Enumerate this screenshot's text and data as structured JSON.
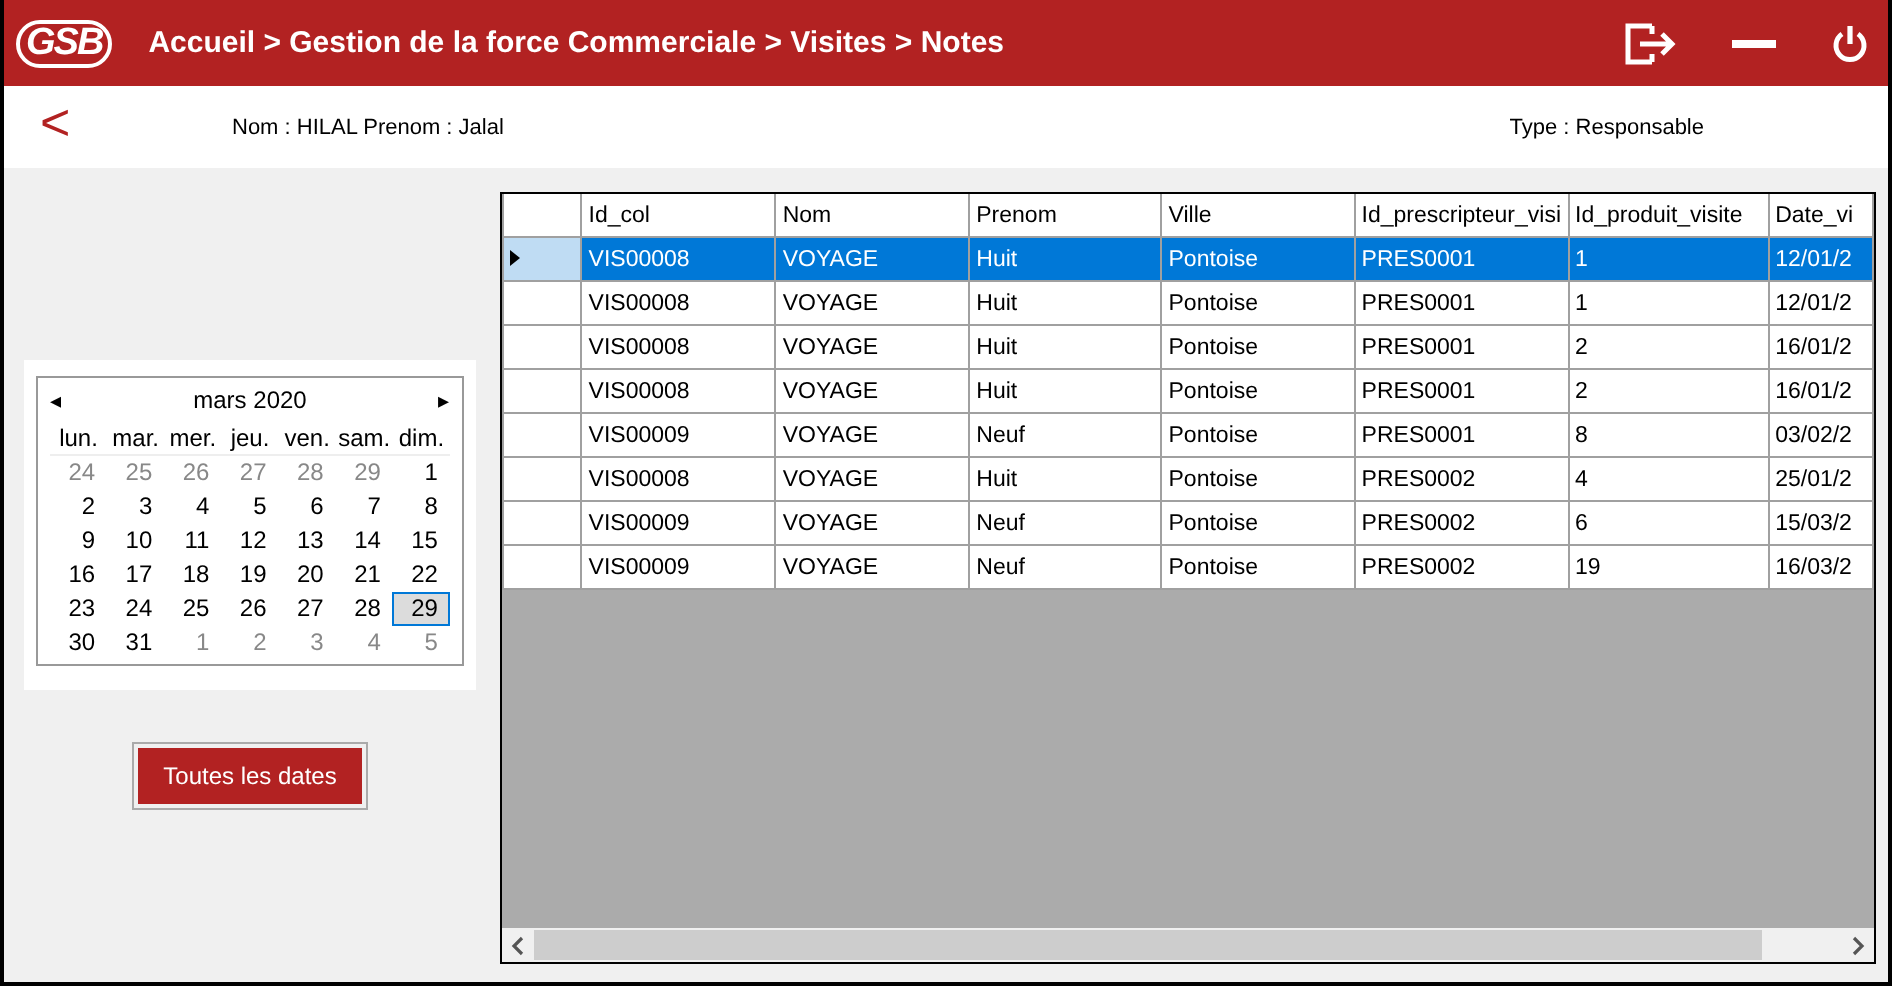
{
  "header": {
    "logo": "GSB",
    "breadcrumb": "Accueil > Gestion de la force Commerciale > Visites > Notes"
  },
  "info": {
    "back": "<",
    "user": "Nom : HILAL  Prenom : Jalal",
    "type": "Type : Responsable"
  },
  "calendar": {
    "prev": "◂",
    "next": "▸",
    "month": "mars 2020",
    "weekdays": [
      "lun.",
      "mar.",
      "mer.",
      "jeu.",
      "ven.",
      "sam.",
      "dim."
    ],
    "days": [
      {
        "label": "24",
        "other": true,
        "selected": false
      },
      {
        "label": "25",
        "other": true,
        "selected": false
      },
      {
        "label": "26",
        "other": true,
        "selected": false
      },
      {
        "label": "27",
        "other": true,
        "selected": false
      },
      {
        "label": "28",
        "other": true,
        "selected": false
      },
      {
        "label": "29",
        "other": true,
        "selected": false
      },
      {
        "label": "1",
        "other": false,
        "selected": false
      },
      {
        "label": "2",
        "other": false,
        "selected": false
      },
      {
        "label": "3",
        "other": false,
        "selected": false
      },
      {
        "label": "4",
        "other": false,
        "selected": false
      },
      {
        "label": "5",
        "other": false,
        "selected": false
      },
      {
        "label": "6",
        "other": false,
        "selected": false
      },
      {
        "label": "7",
        "other": false,
        "selected": false
      },
      {
        "label": "8",
        "other": false,
        "selected": false
      },
      {
        "label": "9",
        "other": false,
        "selected": false
      },
      {
        "label": "10",
        "other": false,
        "selected": false
      },
      {
        "label": "11",
        "other": false,
        "selected": false
      },
      {
        "label": "12",
        "other": false,
        "selected": false
      },
      {
        "label": "13",
        "other": false,
        "selected": false
      },
      {
        "label": "14",
        "other": false,
        "selected": false
      },
      {
        "label": "15",
        "other": false,
        "selected": false
      },
      {
        "label": "16",
        "other": false,
        "selected": false
      },
      {
        "label": "17",
        "other": false,
        "selected": false
      },
      {
        "label": "18",
        "other": false,
        "selected": false
      },
      {
        "label": "19",
        "other": false,
        "selected": false
      },
      {
        "label": "20",
        "other": false,
        "selected": false
      },
      {
        "label": "21",
        "other": false,
        "selected": false
      },
      {
        "label": "22",
        "other": false,
        "selected": false
      },
      {
        "label": "23",
        "other": false,
        "selected": false
      },
      {
        "label": "24",
        "other": false,
        "selected": false
      },
      {
        "label": "25",
        "other": false,
        "selected": false
      },
      {
        "label": "26",
        "other": false,
        "selected": false
      },
      {
        "label": "27",
        "other": false,
        "selected": false
      },
      {
        "label": "28",
        "other": false,
        "selected": false
      },
      {
        "label": "29",
        "other": false,
        "selected": true
      },
      {
        "label": "30",
        "other": false,
        "selected": false
      },
      {
        "label": "31",
        "other": false,
        "selected": false
      },
      {
        "label": "1",
        "other": true,
        "selected": false
      },
      {
        "label": "2",
        "other": true,
        "selected": false
      },
      {
        "label": "3",
        "other": true,
        "selected": false
      },
      {
        "label": "4",
        "other": true,
        "selected": false
      },
      {
        "label": "5",
        "other": true,
        "selected": false
      }
    ]
  },
  "all_dates_button": "Toutes les dates",
  "table": {
    "columns": [
      "Id_col",
      "Nom",
      "Prenom",
      "Ville",
      "Id_prescripteur_visi",
      "Id_produit_visite",
      "Date_vi"
    ],
    "rows": [
      {
        "selected": true,
        "cells": [
          "VIS00008",
          "VOYAGE",
          "Huit",
          "Pontoise",
          "PRES0001",
          "1",
          "12/01/2"
        ]
      },
      {
        "selected": false,
        "cells": [
          "VIS00008",
          "VOYAGE",
          "Huit",
          "Pontoise",
          "PRES0001",
          "1",
          "12/01/2"
        ]
      },
      {
        "selected": false,
        "cells": [
          "VIS00008",
          "VOYAGE",
          "Huit",
          "Pontoise",
          "PRES0001",
          "2",
          "16/01/2"
        ]
      },
      {
        "selected": false,
        "cells": [
          "VIS00008",
          "VOYAGE",
          "Huit",
          "Pontoise",
          "PRES0001",
          "2",
          "16/01/2"
        ]
      },
      {
        "selected": false,
        "cells": [
          "VIS00009",
          "VOYAGE",
          "Neuf",
          "Pontoise",
          "PRES0001",
          "8",
          "03/02/2"
        ]
      },
      {
        "selected": false,
        "cells": [
          "VIS00008",
          "VOYAGE",
          "Huit",
          "Pontoise",
          "PRES0002",
          "4",
          "25/01/2"
        ]
      },
      {
        "selected": false,
        "cells": [
          "VIS00009",
          "VOYAGE",
          "Neuf",
          "Pontoise",
          "PRES0002",
          "6",
          "15/03/2"
        ]
      },
      {
        "selected": false,
        "cells": [
          "VIS00009",
          "VOYAGE",
          "Neuf",
          "Pontoise",
          "PRES0002",
          "19",
          "16/03/2"
        ]
      }
    ]
  }
}
